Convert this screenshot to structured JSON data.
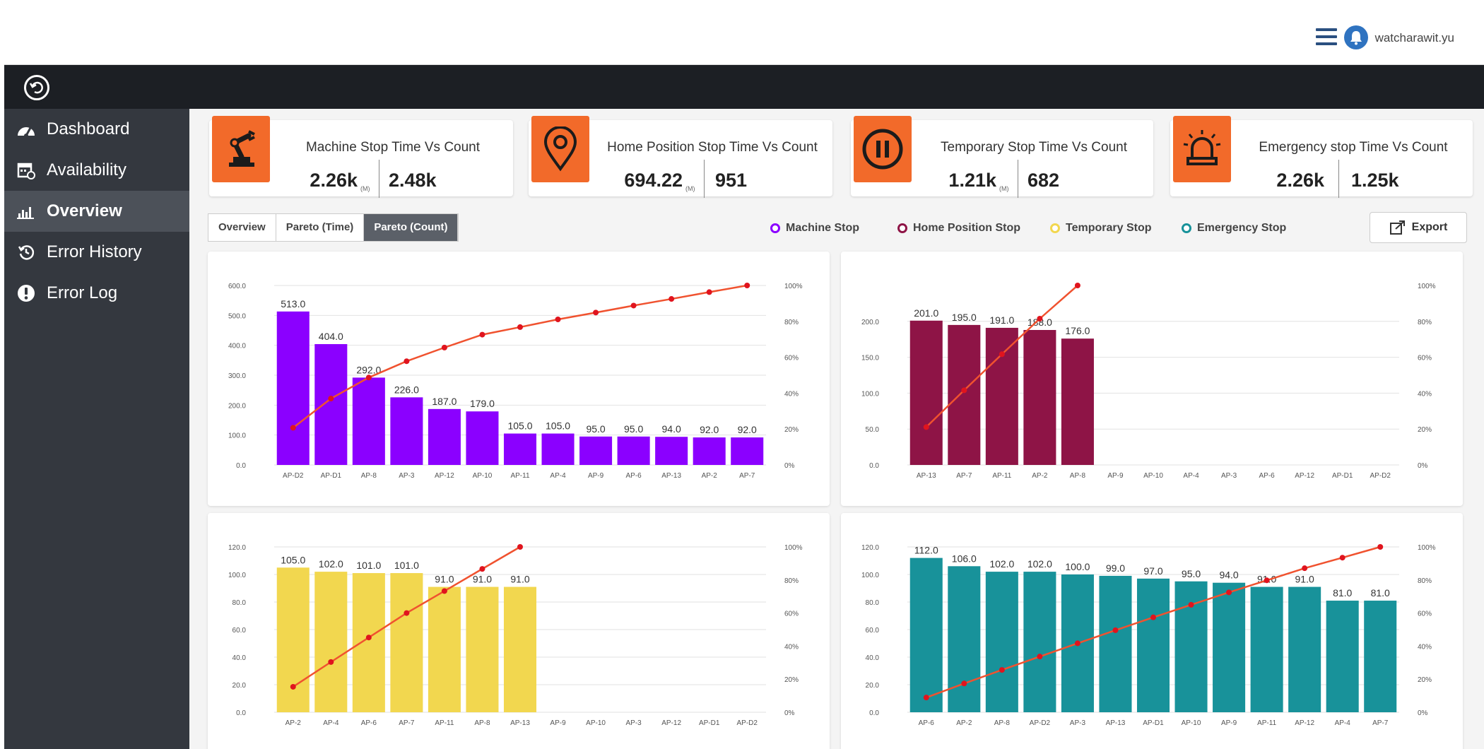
{
  "header": {
    "username": "watcharawit.yu"
  },
  "icons": {
    "menu": "hamburger-icon",
    "notification": "bell-icon",
    "back": "back-arrow-icon",
    "close": "close-icon"
  },
  "sidebar": {
    "items": [
      {
        "label": "Dashboard",
        "icon": "speedometer-icon"
      },
      {
        "label": "Availability",
        "icon": "calendar-icon"
      },
      {
        "label": "Overview",
        "icon": "bar-chart-icon",
        "active": true
      },
      {
        "label": "Error History",
        "icon": "history-icon"
      },
      {
        "label": "Error Log",
        "icon": "alert-circle-icon"
      }
    ]
  },
  "kpis": [
    {
      "title": "Machine Stop Time Vs Count",
      "time": "2.26k",
      "unit": "(M)",
      "count": "2.48k",
      "icon": "robot-arm-icon"
    },
    {
      "title": "Home Position Stop Time Vs Count",
      "time": "694.22",
      "unit": "(M)",
      "count": "951",
      "icon": "location-pin-icon"
    },
    {
      "title": "Temporary Stop Time Vs Count",
      "time": "1.21k",
      "unit": "(M)",
      "count": "682",
      "icon": "pause-icon"
    },
    {
      "title": "Emergency stop Time Vs Count",
      "time": "2.26k",
      "unit": "",
      "count": "1.25k",
      "icon": "siren-icon"
    }
  ],
  "tabs": [
    "Overview",
    "Pareto (Time)",
    "Pareto (Count)"
  ],
  "active_tab": "Pareto (Count)",
  "legend": [
    {
      "label": "Machine Stop",
      "color": "#8b00ff"
    },
    {
      "label": "Home Position Stop",
      "color": "#8e1446"
    },
    {
      "label": "Temporary Stop",
      "color": "#f2d74f"
    },
    {
      "label": "Emergency Stop",
      "color": "#18929a"
    }
  ],
  "export_label": "Export",
  "colors": {
    "accent": "#f26a2a",
    "pareto_line": "#f0522f",
    "pareto_dot": "#e0141e"
  },
  "chart_data": [
    {
      "type": "bar",
      "name": "Machine Stop",
      "color": "#8b00ff",
      "categories": [
        "AP-D2",
        "AP-D1",
        "AP-8",
        "AP-3",
        "AP-12",
        "AP-10",
        "AP-11",
        "AP-4",
        "AP-9",
        "AP-6",
        "AP-13",
        "AP-2",
        "AP-7"
      ],
      "values": [
        513,
        404,
        292,
        226,
        187,
        179,
        105,
        105,
        95,
        95,
        94,
        92,
        92
      ],
      "cumulative_percent": [
        20.7,
        37.0,
        48.7,
        57.8,
        65.4,
        72.6,
        76.8,
        81.1,
        84.9,
        88.8,
        92.5,
        96.3,
        100
      ],
      "ylim": [
        0,
        600
      ],
      "yticks": [
        "0.0",
        "100.0",
        "200.0",
        "300.0",
        "400.0",
        "500.0",
        "600.0"
      ],
      "y2ticks": [
        "0%",
        "20%",
        "40%",
        "60%",
        "80%",
        "100%"
      ],
      "grid": true
    },
    {
      "type": "bar",
      "name": "Home Position Stop",
      "color": "#8e1446",
      "categories": [
        "AP-13",
        "AP-7",
        "AP-11",
        "AP-2",
        "AP-8",
        "AP-9",
        "AP-10",
        "AP-4",
        "AP-3",
        "AP-6",
        "AP-12",
        "AP-D1",
        "AP-D2"
      ],
      "values": [
        201,
        195,
        191,
        188,
        176,
        null,
        null,
        null,
        null,
        null,
        null,
        null,
        null
      ],
      "cumulative_percent": [
        21.1,
        41.6,
        61.7,
        81.5,
        100,
        null,
        null,
        null,
        null,
        null,
        null,
        null,
        null
      ],
      "ylim": [
        0,
        250
      ],
      "yticks": [
        "0.0",
        "50.0",
        "100.0",
        "150.0",
        "200.0"
      ],
      "y2ticks": [
        "0%",
        "20%",
        "40%",
        "60%",
        "80%",
        "100%"
      ],
      "grid": true
    },
    {
      "type": "bar",
      "name": "Temporary Stop",
      "color": "#f2d74f",
      "categories": [
        "AP-2",
        "AP-4",
        "AP-6",
        "AP-7",
        "AP-11",
        "AP-8",
        "AP-13",
        "AP-9",
        "AP-10",
        "AP-3",
        "AP-12",
        "AP-D1",
        "AP-D2"
      ],
      "values": [
        105,
        102,
        101,
        101,
        91,
        91,
        91,
        null,
        null,
        null,
        null,
        null,
        null
      ],
      "cumulative_percent": [
        15.4,
        30.4,
        45.2,
        60.0,
        73.3,
        86.7,
        100,
        null,
        null,
        null,
        null,
        null,
        null
      ],
      "ylim": [
        0,
        120
      ],
      "yticks": [
        "0.0",
        "20.0",
        "40.0",
        "60.0",
        "80.0",
        "100.0",
        "120.0"
      ],
      "y2ticks": [
        "0%",
        "20%",
        "40%",
        "60%",
        "80%",
        "100%"
      ],
      "grid": true
    },
    {
      "type": "bar",
      "name": "Emergency Stop",
      "color": "#18929a",
      "categories": [
        "AP-6",
        "AP-2",
        "AP-8",
        "AP-D2",
        "AP-3",
        "AP-13",
        "AP-D1",
        "AP-10",
        "AP-9",
        "AP-11",
        "AP-12",
        "AP-4",
        "AP-7"
      ],
      "values": [
        112,
        106,
        102,
        102,
        100,
        99,
        97,
        95,
        94,
        91,
        91,
        81,
        81
      ],
      "cumulative_percent": [
        8.9,
        17.4,
        25.6,
        33.7,
        41.7,
        49.6,
        57.4,
        65.0,
        72.5,
        79.8,
        87.1,
        93.5,
        100
      ],
      "ylim": [
        0,
        120
      ],
      "yticks": [
        "0.0",
        "20.0",
        "40.0",
        "60.0",
        "80.0",
        "100.0",
        "120.0"
      ],
      "y2ticks": [
        "0%",
        "20%",
        "40%",
        "60%",
        "80%",
        "100%"
      ],
      "grid": true
    }
  ]
}
